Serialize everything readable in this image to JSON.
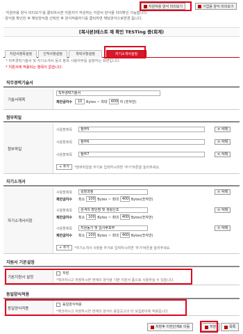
{
  "top_buttons": {
    "applicant_form_preview": "지원자용 양식 미리보기",
    "company_form_preview": "기업용 양식 미리보기"
  },
  "notes": [
    "· '지원자용 양식 미리보기'를 클릭하시면 지원자가 작성하는 지원서 양식을 미리확인 가능합니다.",
    "· 양식을 확인한 후 해당양식을 선택한 후 양식적용하기를 클릭하면 해당양식으로변경 됩니다."
  ],
  "form_title": "[복사본]테스트 재 확인 TESTing 중(회계)",
  "tabs": [
    "지원서항목설정",
    "인적사항설정",
    "학력사항설정",
    "자기소개서설정"
  ],
  "tab_notes": {
    "note1": "* 직무경력기술서 및 자기소개서 등의 항목 사용여부를 설정하는 화면입니다.",
    "note2": "* 지원서에 적용되는 항목이 없습니다."
  },
  "career": {
    "heading": "직무경력기술서",
    "label": "기술서제목",
    "title_value": "직무경력기술서",
    "limit_label": "제한글자수",
    "limit_min": "10",
    "limit_unit": "Bytes ~ 최대",
    "limit_max": "4000",
    "limit_suffix": "자 (숫자만)"
  },
  "attachment": {
    "heading": "첨부파일",
    "label": "첨부파일",
    "item_label": "사용할제목",
    "items": [
      "첨부5",
      "첨부6",
      "첨부7"
    ],
    "delete_label": "× 삭제",
    "add_label": "+ 추가",
    "add_note": "*첨부파일을 추가로 입력하시려면 '추가'버튼을 눌러주세요."
  },
  "intro": {
    "heading": "자기소개서",
    "label": "자기소개서사항",
    "item_label": "사용할제목",
    "limit_label": "제한글자수",
    "min_label": "최소",
    "unit1": "Bytes ~ 최대",
    "unit2": "Bytes(숫자만)",
    "items": [
      {
        "title": "성장과정",
        "min": "100",
        "max": "4000"
      },
      {
        "title": "성격의 장단점 및 생활신조",
        "min": "100",
        "max": "4000"
      },
      {
        "title": "지원동기 및 입사후포부",
        "min": "100",
        "max": "4000"
      }
    ],
    "delete_label": "× 삭제",
    "add_label": "+ 추가",
    "add_note": "*자기소개서 사항을 추가로 입력하시려면 '추가'버튼을 눌러주세요."
  },
  "basic_setting": {
    "heading": "지원서 기본설정",
    "label": "기본지원서 설정",
    "checkbox_label": "저장",
    "note": "*체크하시고 저장하시면 현재의 양식을 기본 지원서 폼으로 사용하실 수 있습니다."
  },
  "same_form": {
    "heading": "동일양식적용",
    "label": "동일양식적용",
    "checkbox_label": "동일양식적용",
    "note": "*체크하시고 저장하시면 현재의 양식이 동일공고의 타 모집분야에 적용됩니다."
  },
  "bottom_buttons": {
    "save_and_next": "저장후 이전단계로 이동",
    "save": "저장",
    "list": "목록"
  }
}
